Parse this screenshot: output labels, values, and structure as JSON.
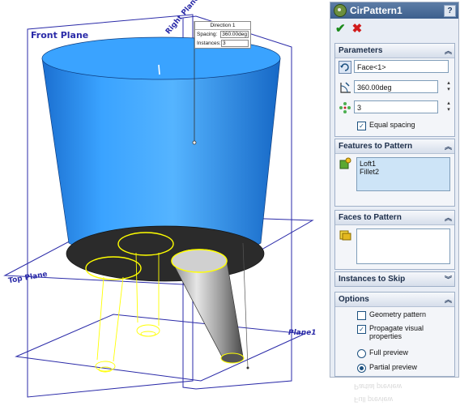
{
  "viewport": {
    "planes": {
      "front": "Front Plane",
      "right": "Right Plane",
      "top": "Top Plane",
      "plane1": "Plane1"
    },
    "callout": {
      "title": "Direction 1",
      "spacing_label": "Spacing:",
      "spacing_value": "360.00deg",
      "instances_label": "Instances:",
      "instances_value": "3"
    },
    "colors": {
      "body_blue": "#1e90ff",
      "plane_blue": "#2a2aa8",
      "preview_yellow": "#ffff00"
    }
  },
  "panel": {
    "title": "CirPattern1",
    "help": "?",
    "ok_icon": "checkmark-icon",
    "cancel_icon": "x-icon",
    "parameters": {
      "header": "Parameters",
      "axis_value": "Face<1>",
      "angle_value": "360.00deg",
      "instances_value": "3",
      "equal_spacing_label": "Equal spacing",
      "equal_spacing_checked": true
    },
    "features": {
      "header": "Features to Pattern",
      "items": [
        "Loft1",
        "Fillet2"
      ]
    },
    "faces": {
      "header": "Faces to Pattern"
    },
    "skip": {
      "header": "Instances to Skip"
    },
    "options": {
      "header": "Options",
      "geometry_pattern": "Geometry pattern",
      "geometry_checked": false,
      "propagate_line1": "Propagate visual",
      "propagate_line2": "properties",
      "propagate_checked": true,
      "full_preview": "Full preview",
      "partial_preview": "Partial preview",
      "selected_preview": "Partial preview"
    }
  }
}
